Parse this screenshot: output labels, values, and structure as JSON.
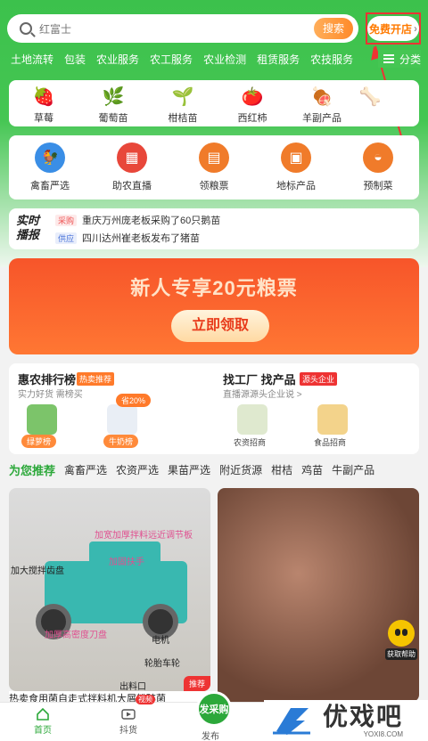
{
  "search": {
    "placeholder": "红富士",
    "button": "搜索"
  },
  "open_store": "免费开店",
  "categories": [
    "土地流转",
    "包装",
    "农业服务",
    "农工服务",
    "农业检测",
    "租赁服务",
    "农技服务"
  ],
  "category_more": "分类",
  "products": [
    {
      "label": "草莓",
      "icon": "strawberry-icon",
      "glyph": "🍓"
    },
    {
      "label": "葡萄苗",
      "icon": "grape-seedling-icon",
      "glyph": "🌿"
    },
    {
      "label": "柑桔苗",
      "icon": "citrus-seedling-icon",
      "glyph": "🌱"
    },
    {
      "label": "西红柿",
      "icon": "tomato-icon",
      "glyph": "🍅"
    },
    {
      "label": "羊副产品",
      "icon": "mutton-icon",
      "glyph": "🍖"
    },
    {
      "label": "",
      "icon": "partial-product-icon",
      "glyph": "🦴"
    }
  ],
  "services": [
    {
      "label": "禽畜严选",
      "color": "#3a8ee6",
      "glyph": "🐓"
    },
    {
      "label": "助农直播",
      "color": "#e8473a",
      "glyph": "▦"
    },
    {
      "label": "领粮票",
      "color": "#f07b2a",
      "glyph": "▤"
    },
    {
      "label": "地标产品",
      "color": "#f07b2a",
      "glyph": "▣"
    },
    {
      "label": "预制菜",
      "color": "#f07b2a",
      "glyph": "◒"
    }
  ],
  "news": {
    "logo_line1": "实时",
    "logo_line2": "播报",
    "items": [
      {
        "tag": "采购",
        "text": "重庆万州庞老板采购了60只鹅苗"
      },
      {
        "tag": "供应",
        "text": "四川达州崔老板发布了猪苗"
      }
    ]
  },
  "banner": {
    "title": "新人专享20元粮票",
    "button": "立即领取"
  },
  "promo_left": {
    "title": "惠农排行榜",
    "badge": "热卖推荐",
    "subtitle": "实力好货 需榜买",
    "pill1": "绿萝榜",
    "pill2": "牛奶榜",
    "discount": "省20%"
  },
  "promo_right": {
    "title": "找工厂 找产品",
    "badge": "源头企业",
    "subtitle": "直播源源头企业说 >",
    "cap1": "农资招商",
    "cap2": "食品招商"
  },
  "tabs": [
    "为您推荐",
    "禽畜严选",
    "农资严选",
    "果苗严选",
    "附近货源",
    "柑桔",
    "鸡苗",
    "牛副产品"
  ],
  "feed_left": {
    "labels": [
      "加大搅拌齿盘",
      "加宽加厚拌料远近调节板",
      "加固扶手",
      "加厚高密度刀盘",
      "电机",
      "轮胎车轮",
      "出料口"
    ],
    "badge": "推荐",
    "title": "热卖食用菌自走式拌料机大屑粉碎菌"
  },
  "help": "获取帮助",
  "bottom_nav": [
    {
      "label": "首页",
      "icon": "home-icon"
    },
    {
      "label": "抖货",
      "icon": "video-icon"
    },
    {
      "label": "发布",
      "icon": "publish-icon"
    }
  ],
  "video_tag": "视频",
  "publish_btn": "发采购",
  "watermark": {
    "big": "优戏吧",
    "small": "YOXI8.COM"
  }
}
